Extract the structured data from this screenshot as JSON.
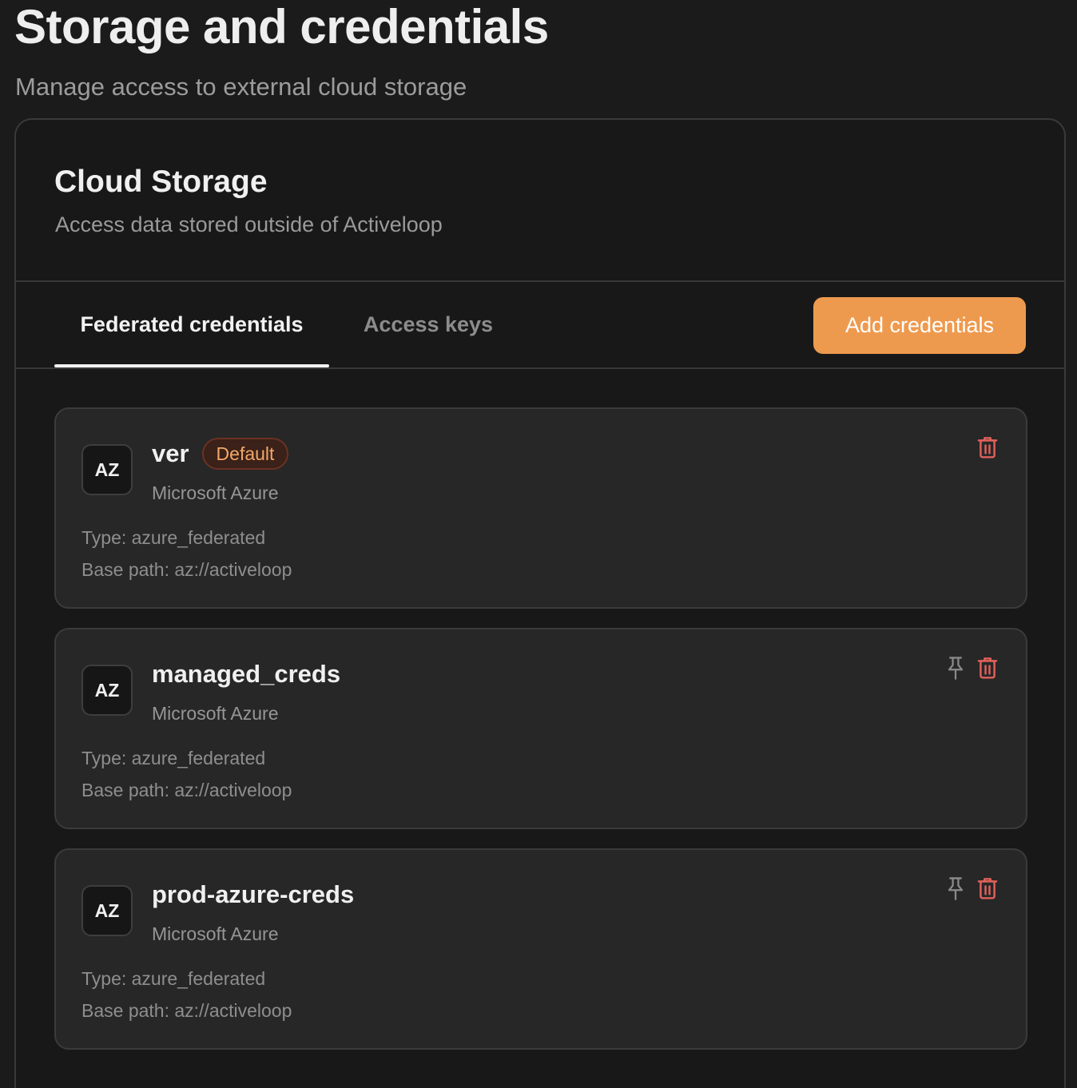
{
  "page": {
    "title": "Storage and credentials",
    "subtitle": "Manage access to external cloud storage"
  },
  "panel": {
    "title": "Cloud Storage",
    "description": "Access data stored outside of Activeloop"
  },
  "tabs": [
    {
      "label": "Federated credentials",
      "active": true
    },
    {
      "label": "Access keys",
      "active": false
    }
  ],
  "add_button": {
    "label": "Add credentials"
  },
  "credentials": [
    {
      "avatar": "AZ",
      "name": "ver",
      "badge": "Default",
      "provider": "Microsoft Azure",
      "type_line": "Type: azure_federated",
      "path_line": "Base path: az://activeloop",
      "actions": [
        "trash-icon"
      ]
    },
    {
      "avatar": "AZ",
      "name": "managed_creds",
      "badge": "",
      "provider": "Microsoft Azure",
      "type_line": "Type: azure_federated",
      "path_line": "Base path: az://activeloop",
      "actions": [
        "pin-icon",
        "trash-icon"
      ]
    },
    {
      "avatar": "AZ",
      "name": "prod-azure-creds",
      "badge": "",
      "provider": "Microsoft Azure",
      "type_line": "Type: azure_federated",
      "path_line": "Base path: az://activeloop",
      "actions": [
        "pin-icon",
        "trash-icon"
      ]
    }
  ],
  "colors": {
    "accent": "#ee9a4e",
    "danger": "#e0605a",
    "badge_text": "#f2a767",
    "background": "#1b1b1b",
    "card": "#272727"
  }
}
